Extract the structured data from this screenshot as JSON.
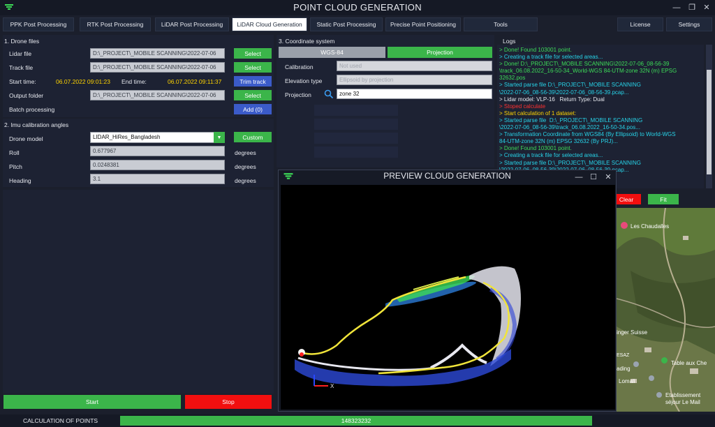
{
  "app": {
    "title": "POINT CLOUD GENERATION"
  },
  "tabs": [
    {
      "label": "PPK Post Processing"
    },
    {
      "label": "RTK Post Processing"
    },
    {
      "label": "LiDAR Post Processing"
    },
    {
      "label": "LiDAR Cloud Generation"
    },
    {
      "label": "Static Post Processing"
    },
    {
      "label": "Precise Point Positioning"
    },
    {
      "label": "Tools"
    },
    {
      "label": "License"
    },
    {
      "label": "Settings"
    }
  ],
  "drone": {
    "title": "1. Drone files",
    "lidar_label": "Lidar file",
    "lidar_value": "D:\\_PROJECT\\_MOBILE SCANNING\\2022-07-06",
    "track_label": "Track file",
    "track_value": "D:\\_PROJECT\\_MOBILE SCANNING\\2022-07-06",
    "select": "Select",
    "start_label": "Start time:",
    "start_value": "06.07.2022 09:01:23",
    "end_label": "End time:",
    "end_value": "06.07.2022 09:11:37",
    "trim": "Trim track",
    "output_label": "Output folder",
    "output_value": "D:\\_PROJECT\\_MOBILE SCANNING\\2022-07-06",
    "batch_label": "Batch processing",
    "add": "Add (0)"
  },
  "imu": {
    "title": "2. Imu calibration angles",
    "model_label": "Drone model",
    "model_value": "LIDAR_HiRes_Bangladesh",
    "custom": "Custom",
    "roll_label": "Roll",
    "roll_value": "0.677967",
    "pitch_label": "Pitch",
    "pitch_value": "0.0248381",
    "heading_label": "Heading",
    "heading_value": "3.1",
    "unit": "degrees"
  },
  "coord": {
    "title": "3. Coordinate system",
    "wgs": "WGS-84",
    "projection_btn": "Projection",
    "calibration_label": "Calibration",
    "calibration_value": "Not used",
    "elevation_label": "Elevation type",
    "elevation_value": "Ellipsoid by projection",
    "projection_label": "Projection",
    "projection_value": "zone 32"
  },
  "logs": {
    "title": "Logs",
    "lines": [
      {
        "text": "> Done! Found 103001 point.",
        "color": "green"
      },
      {
        "text": "> Creating a track file for selected areas...",
        "color": "cyan"
      },
      {
        "text": "> Done! D:\\_PROJECT\\_MOBILE SCANNING\\2022-07-06_08-56-39",
        "color": "green"
      },
      {
        "text": "\\track_06.08.2022_16-50-34_World-WGS 84-UTM-zone 32N (m) EPSG",
        "color": "green"
      },
      {
        "text": "32632.pos",
        "color": "green"
      },
      {
        "text": "> Started parse file D:\\_PROJECT\\_MOBILE SCANNING",
        "color": "cyan"
      },
      {
        "text": "\\2022-07-06_08-56-39\\2022-07-06_08-56-39.pcap...",
        "color": "cyan"
      },
      {
        "text": "> Lidar model: VLP-16   Return Type: Dual",
        "color": "white"
      },
      {
        "text": "> Stoped calculate",
        "color": "red"
      },
      {
        "text": "> Start calculation of 1 dataset:",
        "color": "yellow"
      },
      {
        "text": "> Started parse file  D:\\_PROJECT\\_MOBILE SCANNING",
        "color": "cyan"
      },
      {
        "text": "\\2022-07-06_08-56-39\\track_06.08.2022_16-50-34.pos...",
        "color": "cyan"
      },
      {
        "text": "> Transformation Coordinate from WGS84 (By Ellipsoid) to World-WGS",
        "color": "cyan"
      },
      {
        "text": "84-UTM-zone 32N (m) EPSG 32632 (By PRJ)...",
        "color": "cyan"
      },
      {
        "text": "> Done! Found 103001 point.",
        "color": "green"
      },
      {
        "text": "> Creating a track file for selected areas...",
        "color": "cyan"
      },
      {
        "text": "> Started parse file D:\\_PROJECT\\_MOBILE SCANNING",
        "color": "cyan"
      },
      {
        "text": "\\2022-07-06_08-56-39\\2022-07-06_08-56-39.pcap...",
        "color": "cyan"
      }
    ]
  },
  "map": {
    "clear": "Clear",
    "fit": "Fit",
    "places": [
      {
        "label": "Les Chaudalles"
      },
      {
        "label": "inger Suisse"
      },
      {
        "label": "ESAZ"
      },
      {
        "label": "Table aux Che"
      },
      {
        "label": "ading"
      },
      {
        "label": "Lomali"
      },
      {
        "label": "Etablissement"
      },
      {
        "label": "séjour Le Mail"
      }
    ]
  },
  "preview": {
    "title": "PREVIEW CLOUD GENERATION",
    "axis": "X"
  },
  "actions": {
    "start": "Start",
    "stop": "Stop"
  },
  "status": {
    "label": "CALCULATION OF POINTS",
    "value": "148323232",
    "progress": 1.0
  }
}
